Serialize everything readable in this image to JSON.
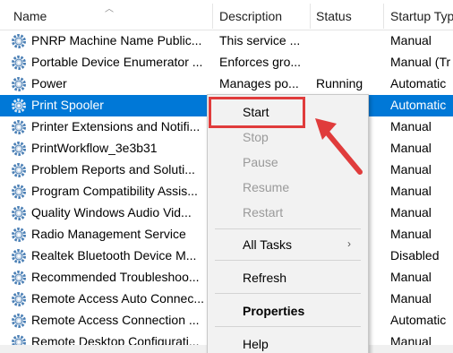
{
  "columns": {
    "name": "Name",
    "description": "Description",
    "status": "Status",
    "startup_type": "Startup Typ"
  },
  "rows": [
    {
      "name": "PNRP Machine Name Public...",
      "description": "This service ...",
      "status": "",
      "startup": "Manual"
    },
    {
      "name": "Portable Device Enumerator ...",
      "description": "Enforces gro...",
      "status": "",
      "startup": "Manual (Tr"
    },
    {
      "name": "Power",
      "description": "Manages po...",
      "status": "Running",
      "startup": "Automatic"
    },
    {
      "name": "Print Spooler",
      "description": "",
      "status": "",
      "startup": "Automatic",
      "selected": true
    },
    {
      "name": "Printer Extensions and Notifi...",
      "description": "",
      "status": "",
      "startup": "Manual"
    },
    {
      "name": "PrintWorkflow_3e3b31",
      "description": "",
      "status": "",
      "startup": "Manual"
    },
    {
      "name": "Problem Reports and Soluti...",
      "description": "",
      "status": "",
      "startup": "Manual"
    },
    {
      "name": "Program Compatibility Assis...",
      "description": "",
      "status": "",
      "startup": "Manual"
    },
    {
      "name": "Quality Windows Audio Vid...",
      "description": "",
      "status": "",
      "startup": "Manual"
    },
    {
      "name": "Radio Management Service",
      "description": "",
      "status": "",
      "startup": "Manual"
    },
    {
      "name": "Realtek Bluetooth Device M...",
      "description": "",
      "status": "",
      "startup": "Disabled"
    },
    {
      "name": "Recommended Troubleshoo...",
      "description": "",
      "status": "",
      "startup": "Manual"
    },
    {
      "name": "Remote Access Auto Connec...",
      "description": "",
      "status": "",
      "startup": "Manual"
    },
    {
      "name": "Remote Access Connection ...",
      "description": "",
      "status": "",
      "startup": "Automatic"
    },
    {
      "name": "Remote Desktop Configurati...",
      "description": "",
      "status": "",
      "startup": "Manual"
    }
  ],
  "context_menu": {
    "start": "Start",
    "stop": "Stop",
    "pause": "Pause",
    "resume": "Resume",
    "restart": "Restart",
    "all_tasks": "All Tasks",
    "all_tasks_chevron": "›",
    "refresh": "Refresh",
    "properties": "Properties",
    "help": "Help"
  },
  "colors": {
    "selection": "#0078d7",
    "highlight_box": "#e03c3c",
    "arrow": "#e03c3c"
  }
}
